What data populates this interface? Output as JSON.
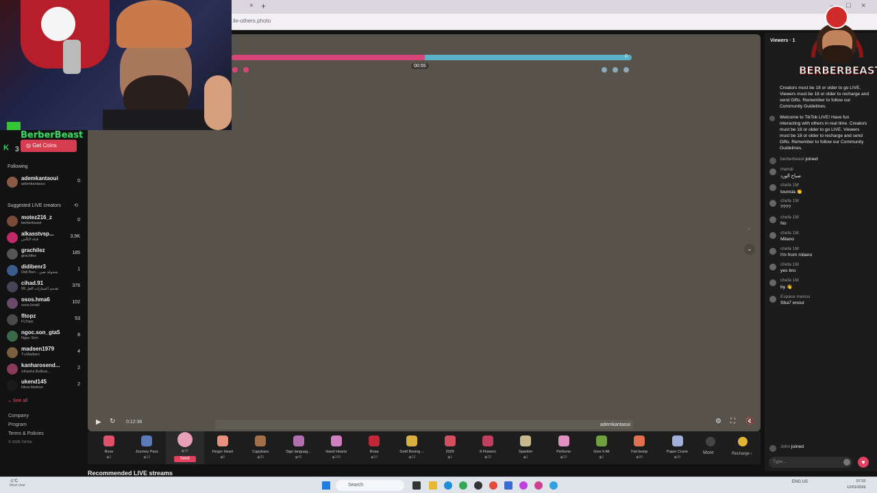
{
  "browser": {
    "tab_close": "×",
    "tab_new": "+",
    "url": "ile-others.photo"
  },
  "brand": {
    "name": "BerberBeast",
    "logo_text": "BERBERBEAST",
    "follow_count": "3"
  },
  "sidebar": {
    "get_coins": "Get Coins",
    "following_title": "Following",
    "following": [
      {
        "name": "ademkantaoui",
        "sub": "ademkantaoui",
        "count": "0",
        "color": "#8a5a44"
      }
    ],
    "suggested_title": "Suggested LIVE creators",
    "suggested": [
      {
        "name": "motez216_z",
        "sub": "berberbeast",
        "count": "0",
        "color": "#7b4b3a"
      },
      {
        "name": "alkasstvsp...",
        "sub": "قناة الكأس",
        "count": "3.9K",
        "color": "#c2286a"
      },
      {
        "name": "grachilez",
        "sub": "grachilez",
        "count": "185",
        "color": "#555"
      },
      {
        "name": "didibenr3",
        "sub": "Didi Ben - شحولة نقبي",
        "count": "1",
        "color": "#3b5c8c"
      },
      {
        "name": "cihad.91",
        "sub": "99 هدمم السيارات العل",
        "count": "376",
        "color": "#445"
      },
      {
        "name": "osos.hma6",
        "sub": "osos.hma6",
        "count": "102",
        "color": "#6a4a6a"
      },
      {
        "name": "fltopz",
        "sub": "FLTopz",
        "count": "53",
        "color": "#4a4a4a"
      },
      {
        "name": "ngoc.son_gta5",
        "sub": "Ngọc Sơn",
        "count": "8",
        "color": "#3a6a4a"
      },
      {
        "name": "madsen1979",
        "sub": "Tv.Madsen",
        "count": "4",
        "color": "#7a6040"
      },
      {
        "name": "kanharosend...",
        "sub": "ខKanha Bellissi...",
        "count": "2",
        "color": "#8a3a5a"
      },
      {
        "name": "ukend145",
        "sub": "kikos likebror",
        "count": "2",
        "color": "#1a1a1a"
      }
    ],
    "see_all": "⌄ See all",
    "footer": [
      "Company",
      "Program",
      "Terms & Policies"
    ],
    "copyright": "© 2026 TikTok"
  },
  "video": {
    "pk_score_right": "0",
    "timer": "00:55",
    "timecode": "0:12:36",
    "cohost_name": "ademkantaoui"
  },
  "gifts": {
    "items": [
      {
        "name": "Rose",
        "price": "◉1",
        "color": "#e0506a"
      },
      {
        "name": "Journey Pass",
        "price": "◉10",
        "color": "#5a7ab8"
      },
      {
        "name": "",
        "price": "◉30",
        "color": "#e8a0b8",
        "selected": true
      },
      {
        "name": "Finger Heart",
        "price": "◉5",
        "color": "#e89080"
      },
      {
        "name": "Capybara",
        "price": "◉30",
        "color": "#a0704a"
      },
      {
        "name": "Sign languag...",
        "price": "◉49",
        "color": "#b070b0"
      },
      {
        "name": "Hand Hearts",
        "price": "◉100",
        "color": "#d080c0"
      },
      {
        "name": "Rosa",
        "price": "◉10",
        "color": "#c0283a"
      },
      {
        "name": "Gold Boxing ...",
        "price": "◉10",
        "color": "#d8b040"
      },
      {
        "name": "2026",
        "price": "◉1",
        "color": "#d05060"
      },
      {
        "name": "8 Flowers",
        "price": "◉20",
        "color": "#c04060"
      },
      {
        "name": "Sparkler",
        "price": "◉1",
        "color": "#c8b890"
      },
      {
        "name": "Perfume",
        "price": "◉20",
        "color": "#e090c0"
      },
      {
        "name": "Give It All",
        "price": "◉1",
        "color": "#70a040"
      },
      {
        "name": "Fist bump",
        "price": "◉90",
        "color": "#e07050"
      },
      {
        "name": "Paper Crane",
        "price": "◉99",
        "color": "#a0b0d8"
      }
    ],
    "send_label": "Send",
    "more_label": "More",
    "recharge_label": "Recharge ›"
  },
  "recommended_title": "Recommended LIVE streams",
  "chat": {
    "title": "Viewers · 1",
    "system_msg_1": "Creators must be 18 or older to go LIVE. Viewers must be 18 or older to recharge and send Gifts. Remember to follow our Community Guidelines.",
    "system_msg_2": "Welcome to TikTok LIVE! Have fun interacting with others in real time. Creators must be 18 or older to go LIVE. Viewers must be 18 or older to recharge and send Gifts. Remember to follow our Community Guidelines.",
    "joined_1_user": "berberbeast",
    "joined_label": "joined",
    "messages": [
      {
        "user": "Hamdi",
        "text": "صباح الورد"
      },
      {
        "user": "chefa 1M",
        "text": "tounsia 👏"
      },
      {
        "user": "chefa 1M",
        "text": "????"
      },
      {
        "user": "chefa 1M",
        "text": "No"
      },
      {
        "user": "chefa 1M",
        "text": "Milano"
      },
      {
        "user": "chefa 1M",
        "text": "I'm from milano"
      },
      {
        "user": "chefa 1M",
        "text": "yes bro"
      },
      {
        "user": "chefa 1M",
        "text": "by 👋"
      },
      {
        "user": "Espace manou",
        "text": "Sba7 enour"
      }
    ],
    "joined_2_user": "John",
    "input_placeholder": "Type..."
  },
  "taskbar": {
    "weather_temp": "-1°C",
    "weather_desc": "Most clear",
    "search": "Search",
    "tray": "ENG US",
    "time": "07:32",
    "date": "12/01/2026"
  }
}
